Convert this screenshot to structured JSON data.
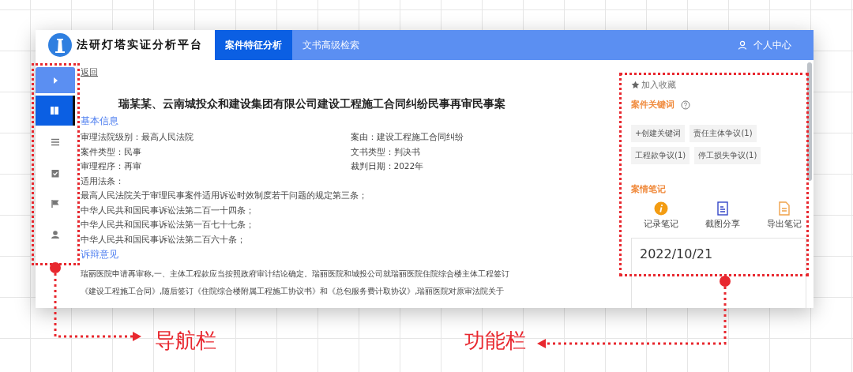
{
  "header": {
    "app_title": "法研灯塔实证分析平台",
    "tabs": [
      {
        "label": "案件特征分析",
        "selected": true
      },
      {
        "label": "文书高级检索",
        "selected": false
      }
    ],
    "user_link": "个人中心"
  },
  "sidebar": {
    "items": [
      {
        "kind": "toggle",
        "selected": false
      },
      {
        "kind": "nav",
        "selected": true
      },
      {
        "kind": "nav",
        "selected": false
      },
      {
        "kind": "nav",
        "selected": false
      },
      {
        "kind": "nav",
        "selected": false
      },
      {
        "kind": "nav",
        "selected": false
      }
    ]
  },
  "document": {
    "back_link": "返回",
    "title": "瑞某某、云南城投众和建设集团有限公司建设工程施工合同纠纷民事再审民事案",
    "basic_info": {
      "heading": "基本信息",
      "left_fields": [
        "审理法院级别：最高人民法院",
        "案件类型：民事",
        "审理程序：再审"
      ],
      "right_fields": [
        "案由：建设工程施工合同纠纷",
        "文书类型：判决书",
        "裁判日期：2022年"
      ],
      "laws_label": "适用法条：",
      "laws": [
        "最高人民法院关于审理民事案件适用诉讼时效制度若干问题的规定第三条；",
        "中华人民共和国民事诉讼法第二百一十四条；",
        "中华人民共和国民事诉讼法第一百七十七条；",
        "中华人民共和国民事诉讼法第二百六十条；"
      ]
    },
    "arguments": {
      "heading": "诉辩意见",
      "lines": [
        "瑞丽医院申请再审称,一、主体工程款应当按照政府审计结论确定。瑞丽医院和城投公司就瑞丽医院住院综合楼主体工程签订",
        "《建设工程施工合同》,随后签订《住院综合楼附属工程施工协议书》和《总包服务费计取协议》,瑞丽医院对原审法院关于"
      ]
    }
  },
  "function_panel": {
    "favorite": "加入收藏",
    "keywords_heading": "案件关键词",
    "keywords": [
      "+创建关键词",
      "责任主体争议(1)",
      "工程款争议(1)",
      "停工损失争议(1)"
    ],
    "notes_heading": "案情笔记",
    "note_actions": [
      {
        "kind": "record",
        "label": "记录笔记"
      },
      {
        "kind": "screenshot",
        "label": "截图分享"
      },
      {
        "kind": "export",
        "label": "导出笔记"
      }
    ],
    "note_date": "2022/10/21"
  },
  "annotations": [
    {
      "label": "导航栏"
    },
    {
      "label": "功能栏"
    }
  ]
}
